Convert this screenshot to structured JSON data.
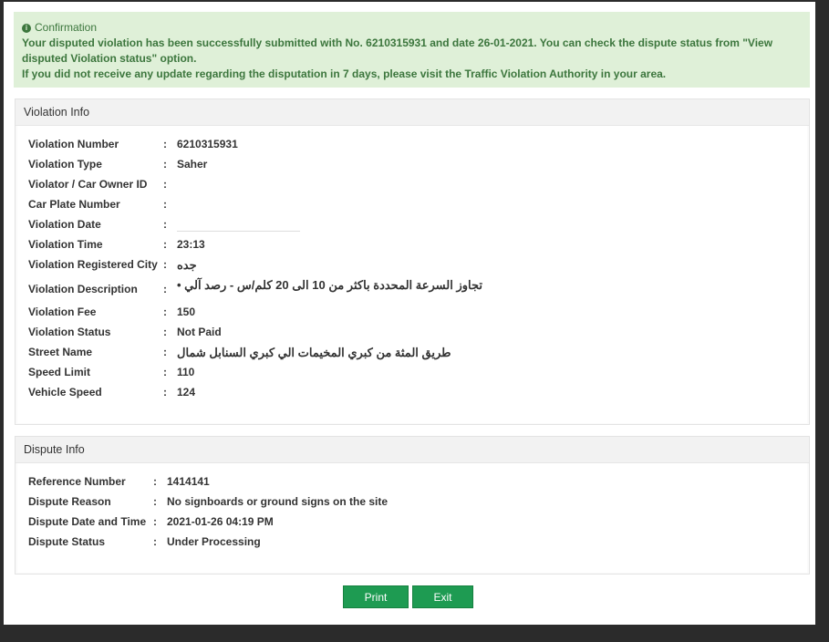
{
  "confirmation": {
    "title": "Confirmation",
    "line1": "Your disputed violation has been successfully submitted with No. 6210315931 and date 26-01-2021. You can check the dispute status from \"View disputed Violation status\" option.",
    "line2": "If you did not receive any update regarding the disputation in 7 days, please visit the Traffic Violation Authority in your area."
  },
  "violation_info": {
    "header": "Violation Info",
    "separator": ":",
    "rows": [
      {
        "label": "Violation Number",
        "value": "6210315931"
      },
      {
        "label": "Violation Type",
        "value": "Saher"
      },
      {
        "label": "Violator / Car Owner ID",
        "value": ""
      },
      {
        "label": "Car Plate Number",
        "value": ""
      },
      {
        "label": "Violation Date",
        "value": ""
      },
      {
        "label": "Violation Time",
        "value": "23:13"
      },
      {
        "label": "Violation Registered City",
        "value": "جده"
      },
      {
        "label": "Violation Description",
        "value": "تجاوز السرعة المحددة باكثر من 10 الى 20 كلم/س - رصد آلي •"
      },
      {
        "label": "Violation Fee",
        "value": "150"
      },
      {
        "label": "Violation Status",
        "value": "Not Paid"
      },
      {
        "label": "Street Name",
        "value": "طريق المثة من كبري المخيمات الي كبري السنابل شمال"
      },
      {
        "label": "Speed Limit",
        "value": "110"
      },
      {
        "label": "Vehicle Speed",
        "value": "124"
      }
    ]
  },
  "dispute_info": {
    "header": "Dispute Info",
    "separator": ":",
    "rows": [
      {
        "label": "Reference Number",
        "value": "1414141"
      },
      {
        "label": "Dispute Reason",
        "value": "No signboards or ground signs on the site"
      },
      {
        "label": "Dispute Date and Time",
        "value": "2021-01-26 04:19 PM"
      },
      {
        "label": "Dispute Status",
        "value": "Under Processing"
      }
    ]
  },
  "buttons": {
    "print": "Print",
    "exit": "Exit"
  },
  "colors": {
    "accent": "#1e9b52",
    "alert_bg": "#dff0d8",
    "alert_text": "#3c763d"
  }
}
